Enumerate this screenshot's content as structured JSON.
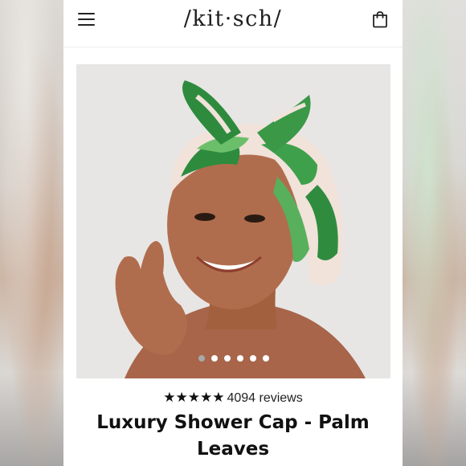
{
  "header": {
    "logo": "/kit·sch/",
    "menu_icon": "hamburger-menu-icon",
    "cart_icon": "shopping-bag-icon"
  },
  "product": {
    "image_alt": "Luxury Shower Cap - Palm Leaves",
    "carousel": {
      "total": 6,
      "active": 1
    },
    "rating": {
      "stars": "★★★★★",
      "reviews": "4094 reviews"
    },
    "title": "Luxury Shower Cap - Palm Leaves"
  },
  "colors": {
    "leaf_green": "#2e8b3e",
    "cap_cream": "#f3e3dc",
    "text": "#111111"
  }
}
